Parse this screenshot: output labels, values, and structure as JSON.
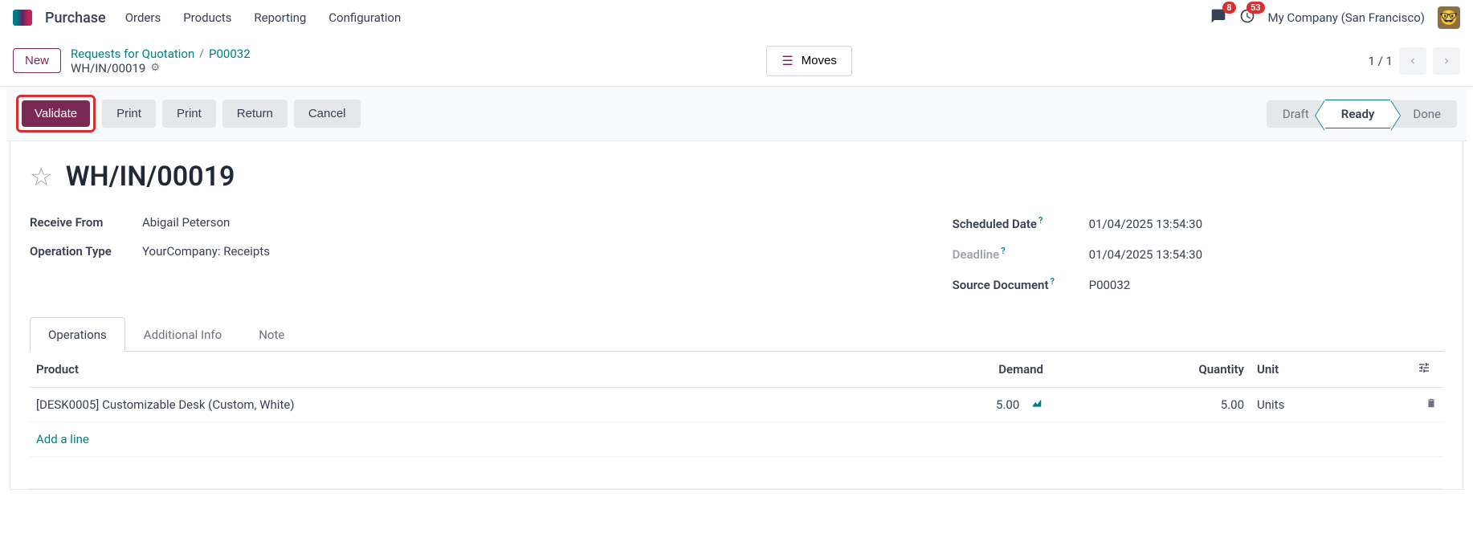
{
  "topbar": {
    "app_title": "Purchase",
    "menu": [
      "Orders",
      "Products",
      "Reporting",
      "Configuration"
    ],
    "msg_badge": "8",
    "activity_badge": "53",
    "company": "My Company (San Francisco)"
  },
  "subbar": {
    "new_label": "New",
    "breadcrumb_root": "Requests for Quotation",
    "breadcrumb_po": "P00032",
    "breadcrumb_current": "WH/IN/00019",
    "moves_label": "Moves",
    "pager": "1 / 1"
  },
  "actions": {
    "validate": "Validate",
    "print1": "Print",
    "print2": "Print",
    "return": "Return",
    "cancel": "Cancel"
  },
  "status": {
    "draft": "Draft",
    "ready": "Ready",
    "done": "Done"
  },
  "record": {
    "title": "WH/IN/00019",
    "receive_from_label": "Receive From",
    "receive_from": "Abigail Peterson",
    "operation_type_label": "Operation Type",
    "operation_type": "YourCompany: Receipts",
    "scheduled_date_label": "Scheduled Date",
    "scheduled_date": "01/04/2025 13:54:30",
    "deadline_label": "Deadline",
    "deadline": "01/04/2025 13:54:30",
    "source_doc_label": "Source Document",
    "source_doc": "P00032"
  },
  "tabs": {
    "operations": "Operations",
    "additional": "Additional Info",
    "note": "Note"
  },
  "table": {
    "headers": {
      "product": "Product",
      "demand": "Demand",
      "quantity": "Quantity",
      "unit": "Unit"
    },
    "rows": [
      {
        "product": "[DESK0005] Customizable Desk (Custom, White)",
        "demand": "5.00",
        "quantity": "5.00",
        "unit": "Units"
      }
    ],
    "add_line": "Add a line"
  }
}
